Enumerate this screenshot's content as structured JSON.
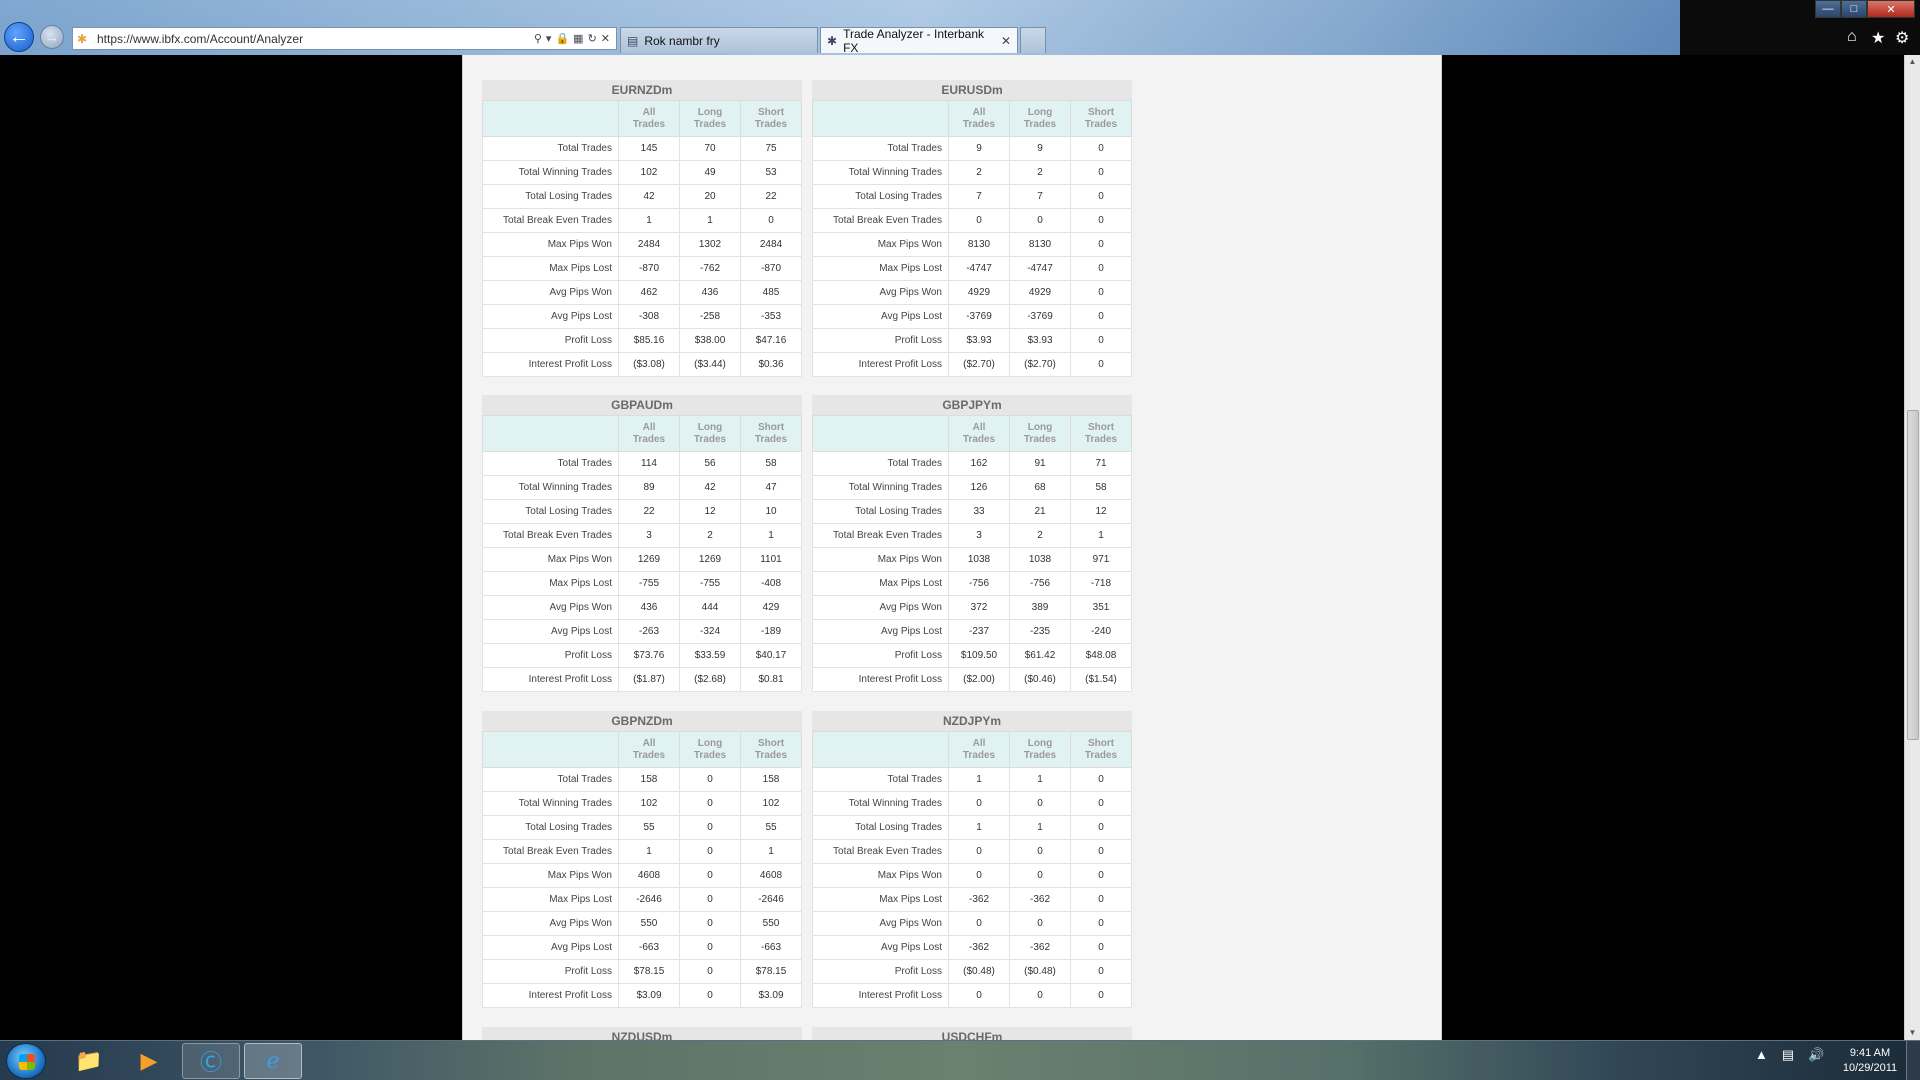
{
  "browser": {
    "url": "https://www.ibfx.com/Account/Analyzer",
    "tabs": [
      {
        "label": "Rok nambr fry"
      },
      {
        "label": "Trade Analyzer - Interbank FX"
      }
    ]
  },
  "columns": {
    "all": [
      "All",
      "Trades"
    ],
    "long": [
      "Long",
      "Trades"
    ],
    "short": [
      "Short",
      "Trades"
    ]
  },
  "blocks": {
    "eurnzd": {
      "title": "EURNZDm",
      "rows": [
        {
          "label": "Total Trades",
          "all": "145",
          "long": "70",
          "short": "75"
        },
        {
          "label": "Total Winning Trades",
          "all": "102",
          "long": "49",
          "short": "53"
        },
        {
          "label": "Total Losing Trades",
          "all": "42",
          "long": "20",
          "short": "22"
        },
        {
          "label": "Total Break Even Trades",
          "all": "1",
          "long": "1",
          "short": "0"
        },
        {
          "label": "Max Pips Won",
          "all": "2484",
          "long": "1302",
          "short": "2484"
        },
        {
          "label": "Max Pips Lost",
          "all": "-870",
          "long": "-762",
          "short": "-870"
        },
        {
          "label": "Avg Pips Won",
          "all": "462",
          "long": "436",
          "short": "485"
        },
        {
          "label": "Avg Pips Lost",
          "all": "-308",
          "long": "-258",
          "short": "-353"
        },
        {
          "label": "Profit Loss",
          "all": "$85.16",
          "long": "$38.00",
          "short": "$47.16"
        },
        {
          "label": "Interest Profit Loss",
          "all": "($3.08)",
          "long": "($3.44)",
          "short": "$0.36"
        }
      ]
    },
    "eurusd": {
      "title": "EURUSDm",
      "rows": [
        {
          "label": "Total Trades",
          "all": "9",
          "long": "9",
          "short": "0"
        },
        {
          "label": "Total Winning Trades",
          "all": "2",
          "long": "2",
          "short": "0"
        },
        {
          "label": "Total Losing Trades",
          "all": "7",
          "long": "7",
          "short": "0"
        },
        {
          "label": "Total Break Even Trades",
          "all": "0",
          "long": "0",
          "short": "0"
        },
        {
          "label": "Max Pips Won",
          "all": "8130",
          "long": "8130",
          "short": "0"
        },
        {
          "label": "Max Pips Lost",
          "all": "-4747",
          "long": "-4747",
          "short": "0"
        },
        {
          "label": "Avg Pips Won",
          "all": "4929",
          "long": "4929",
          "short": "0"
        },
        {
          "label": "Avg Pips Lost",
          "all": "-3769",
          "long": "-3769",
          "short": "0"
        },
        {
          "label": "Profit Loss",
          "all": "$3.93",
          "long": "$3.93",
          "short": "0"
        },
        {
          "label": "Interest Profit Loss",
          "all": "($2.70)",
          "long": "($2.70)",
          "short": "0"
        }
      ]
    },
    "gbpaud": {
      "title": "GBPAUDm",
      "rows": [
        {
          "label": "Total Trades",
          "all": "114",
          "long": "56",
          "short": "58"
        },
        {
          "label": "Total Winning Trades",
          "all": "89",
          "long": "42",
          "short": "47"
        },
        {
          "label": "Total Losing Trades",
          "all": "22",
          "long": "12",
          "short": "10"
        },
        {
          "label": "Total Break Even Trades",
          "all": "3",
          "long": "2",
          "short": "1"
        },
        {
          "label": "Max Pips Won",
          "all": "1269",
          "long": "1269",
          "short": "1101"
        },
        {
          "label": "Max Pips Lost",
          "all": "-755",
          "long": "-755",
          "short": "-408"
        },
        {
          "label": "Avg Pips Won",
          "all": "436",
          "long": "444",
          "short": "429"
        },
        {
          "label": "Avg Pips Lost",
          "all": "-263",
          "long": "-324",
          "short": "-189"
        },
        {
          "label": "Profit Loss",
          "all": "$73.76",
          "long": "$33.59",
          "short": "$40.17"
        },
        {
          "label": "Interest Profit Loss",
          "all": "($1.87)",
          "long": "($2.68)",
          "short": "$0.81"
        }
      ]
    },
    "gbpjpy": {
      "title": "GBPJPYm",
      "rows": [
        {
          "label": "Total Trades",
          "all": "162",
          "long": "91",
          "short": "71"
        },
        {
          "label": "Total Winning Trades",
          "all": "126",
          "long": "68",
          "short": "58"
        },
        {
          "label": "Total Losing Trades",
          "all": "33",
          "long": "21",
          "short": "12"
        },
        {
          "label": "Total Break Even Trades",
          "all": "3",
          "long": "2",
          "short": "1"
        },
        {
          "label": "Max Pips Won",
          "all": "1038",
          "long": "1038",
          "short": "971"
        },
        {
          "label": "Max Pips Lost",
          "all": "-756",
          "long": "-756",
          "short": "-718"
        },
        {
          "label": "Avg Pips Won",
          "all": "372",
          "long": "389",
          "short": "351"
        },
        {
          "label": "Avg Pips Lost",
          "all": "-237",
          "long": "-235",
          "short": "-240"
        },
        {
          "label": "Profit Loss",
          "all": "$109.50",
          "long": "$61.42",
          "short": "$48.08"
        },
        {
          "label": "Interest Profit Loss",
          "all": "($2.00)",
          "long": "($0.46)",
          "short": "($1.54)"
        }
      ]
    },
    "gbpnzd": {
      "title": "GBPNZDm",
      "rows": [
        {
          "label": "Total Trades",
          "all": "158",
          "long": "0",
          "short": "158"
        },
        {
          "label": "Total Winning Trades",
          "all": "102",
          "long": "0",
          "short": "102"
        },
        {
          "label": "Total Losing Trades",
          "all": "55",
          "long": "0",
          "short": "55"
        },
        {
          "label": "Total Break Even Trades",
          "all": "1",
          "long": "0",
          "short": "1"
        },
        {
          "label": "Max Pips Won",
          "all": "4608",
          "long": "0",
          "short": "4608"
        },
        {
          "label": "Max Pips Lost",
          "all": "-2646",
          "long": "0",
          "short": "-2646"
        },
        {
          "label": "Avg Pips Won",
          "all": "550",
          "long": "0",
          "short": "550"
        },
        {
          "label": "Avg Pips Lost",
          "all": "-663",
          "long": "0",
          "short": "-663"
        },
        {
          "label": "Profit Loss",
          "all": "$78.15",
          "long": "0",
          "short": "$78.15"
        },
        {
          "label": "Interest Profit Loss",
          "all": "$3.09",
          "long": "0",
          "short": "$3.09"
        }
      ]
    },
    "nzdjpy": {
      "title": "NZDJPYm",
      "rows": [
        {
          "label": "Total Trades",
          "all": "1",
          "long": "1",
          "short": "0"
        },
        {
          "label": "Total Winning Trades",
          "all": "0",
          "long": "0",
          "short": "0"
        },
        {
          "label": "Total Losing Trades",
          "all": "1",
          "long": "1",
          "short": "0"
        },
        {
          "label": "Total Break Even Trades",
          "all": "0",
          "long": "0",
          "short": "0"
        },
        {
          "label": "Max Pips Won",
          "all": "0",
          "long": "0",
          "short": "0"
        },
        {
          "label": "Max Pips Lost",
          "all": "-362",
          "long": "-362",
          "short": "0"
        },
        {
          "label": "Avg Pips Won",
          "all": "0",
          "long": "0",
          "short": "0"
        },
        {
          "label": "Avg Pips Lost",
          "all": "-362",
          "long": "-362",
          "short": "0"
        },
        {
          "label": "Profit Loss",
          "all": "($0.48)",
          "long": "($0.48)",
          "short": "0"
        },
        {
          "label": "Interest Profit Loss",
          "all": "0",
          "long": "0",
          "short": "0"
        }
      ]
    },
    "nzdusd": {
      "title": "NZDUSDm",
      "rows": []
    },
    "usdchf": {
      "title": "USDCHFm",
      "rows": []
    }
  },
  "taskbar": {
    "clock_time": "9:41 AM",
    "clock_date": "10/29/2011"
  }
}
